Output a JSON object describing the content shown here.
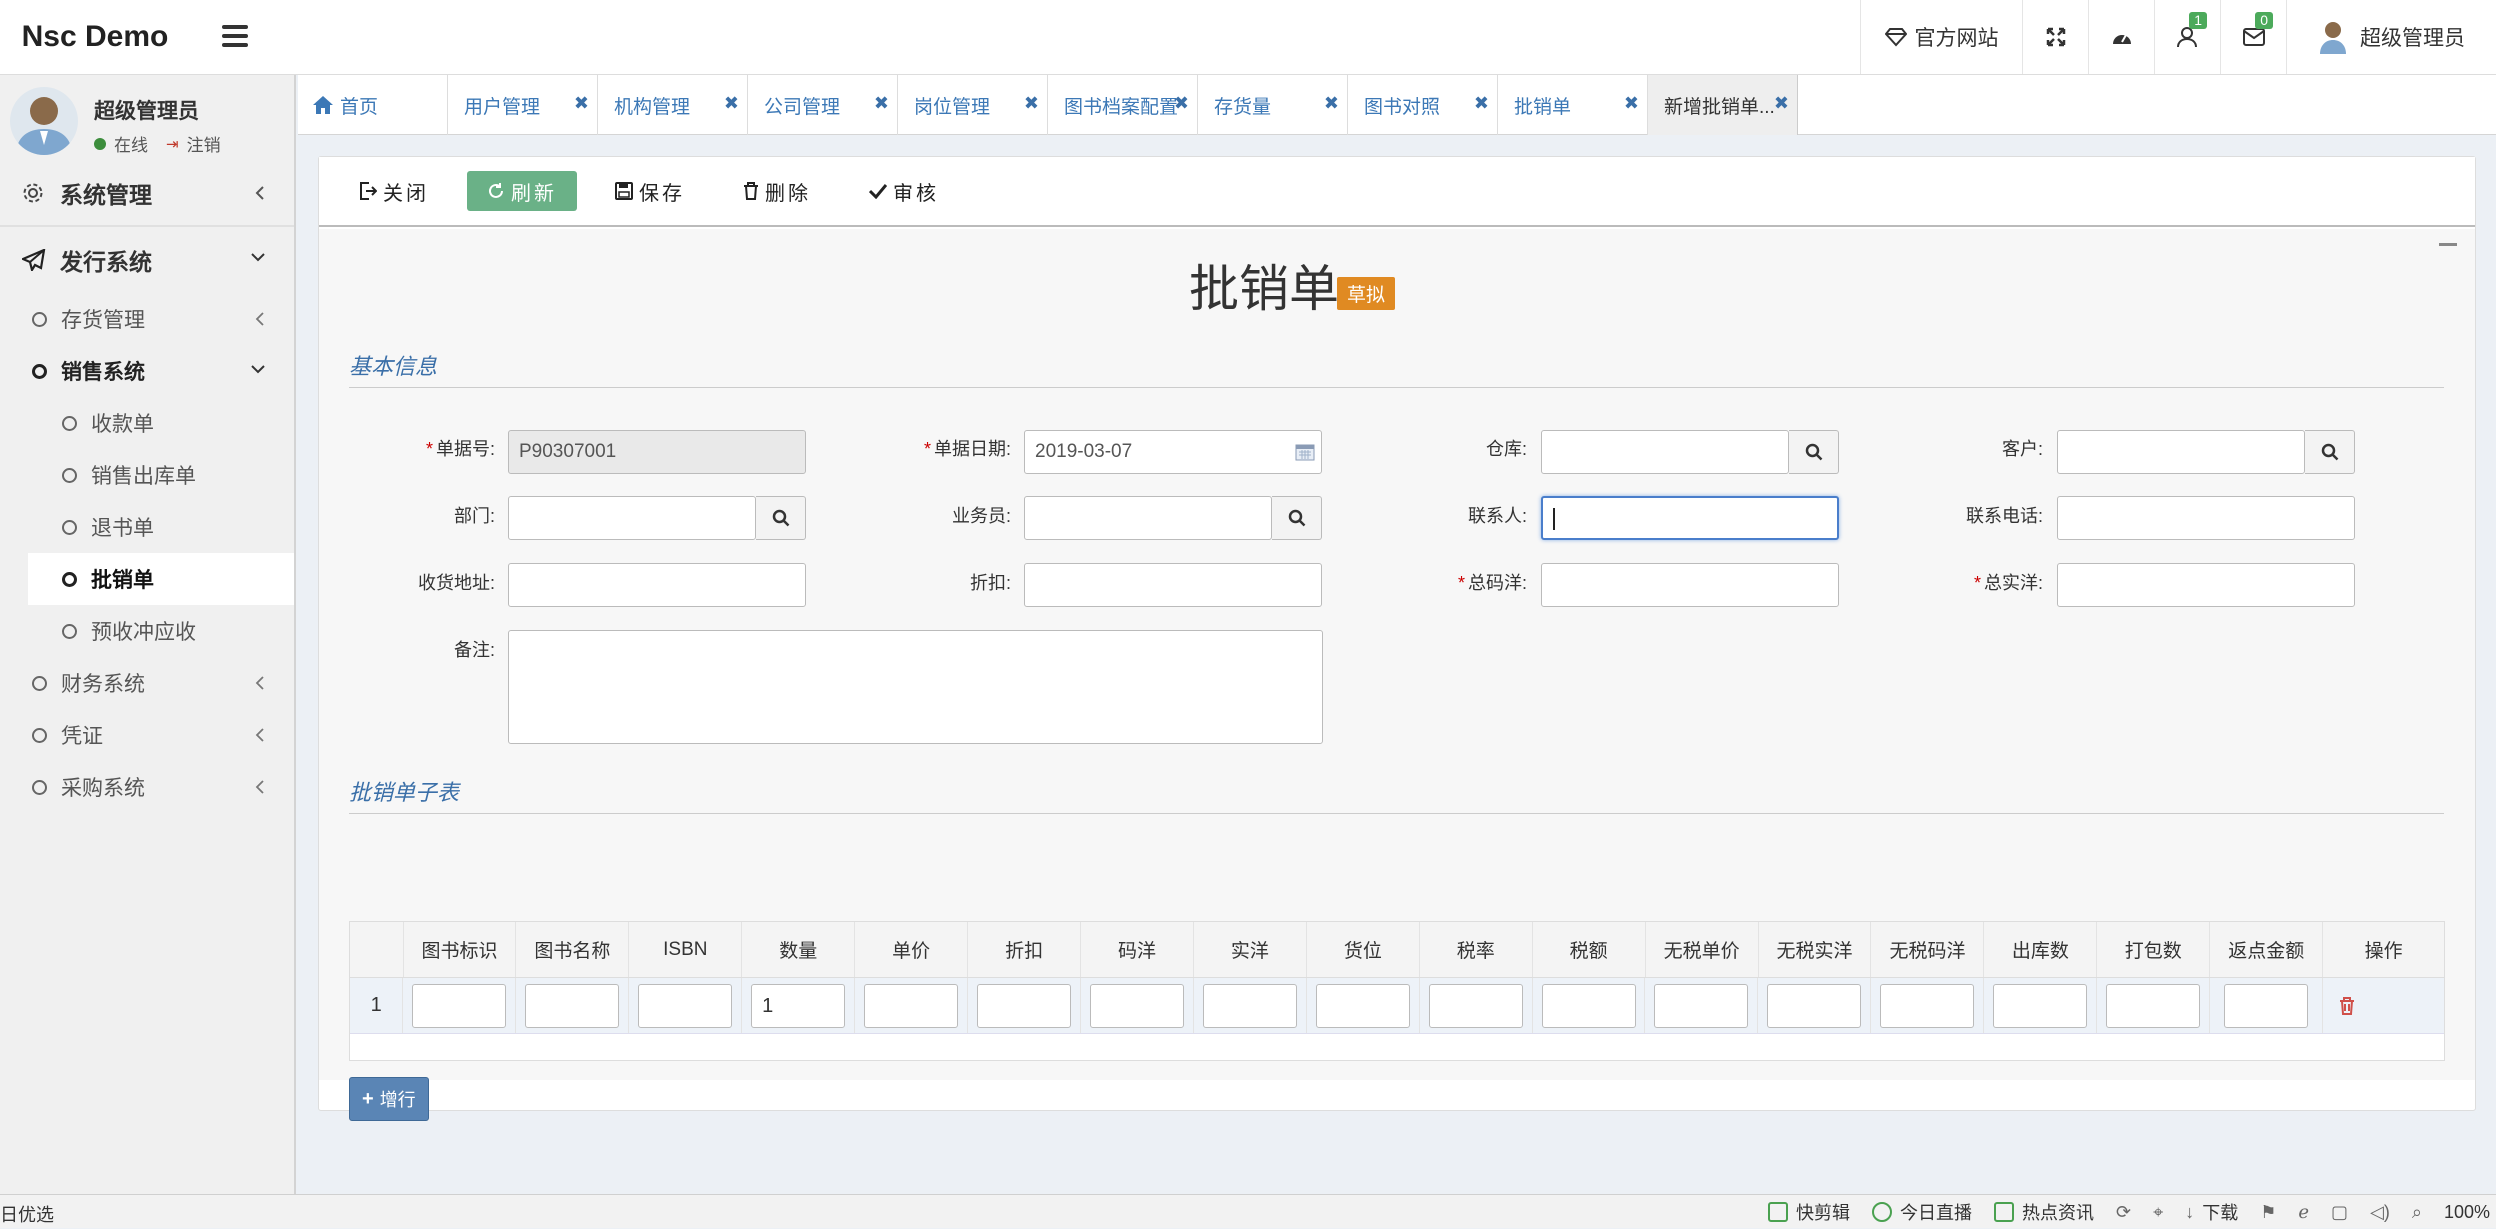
{
  "app": {
    "logo": "Nsc Demo"
  },
  "topnav": {
    "site_label": "官方网站",
    "notif_count": "1",
    "mail_count": "0",
    "user_label": "超级管理员"
  },
  "user": {
    "name": "超级管理员",
    "online": "在线",
    "logout": "注销"
  },
  "sidebar": {
    "system_mgmt": "系统管理",
    "publish": "发行系统",
    "inventory": "存货管理",
    "sales": "销售系统",
    "sales_items": [
      "收款单",
      "销售出库单",
      "退书单",
      "批销单",
      "预收冲应收"
    ],
    "finance": "财务系统",
    "voucher": "凭证",
    "purchase": "采购系统"
  },
  "tabs": {
    "home": "首页",
    "items": [
      "用户管理",
      "机构管理",
      "公司管理",
      "岗位管理",
      "图书档案配置",
      "存货量",
      "图书对照",
      "批销单",
      "新增批销单..."
    ]
  },
  "toolbar": {
    "close": "关闭",
    "refresh": "刷新",
    "save": "保存",
    "delete": "删除",
    "audit": "审核"
  },
  "form": {
    "title": "批销单",
    "status": "草拟",
    "section_basic": "基本信息",
    "section_sub": "批销单子表",
    "labels": {
      "doc_no": "单据号:",
      "doc_date": "单据日期:",
      "warehouse": "仓库:",
      "customer": "客户:",
      "dept": "部门:",
      "salesman": "业务员:",
      "contact": "联系人:",
      "phone": "联系电话:",
      "address": "收货地址:",
      "discount": "折扣:",
      "total_list": "总码洋:",
      "total_actual": "总实洋:",
      "remark": "备注:"
    },
    "values": {
      "doc_no": "P90307001",
      "doc_date": "2019-03-07"
    }
  },
  "grid": {
    "headers": [
      "图书标识",
      "图书名称",
      "ISBN",
      "数量",
      "单价",
      "折扣",
      "码洋",
      "实洋",
      "货位",
      "税率",
      "税额",
      "无税单价",
      "无税实洋",
      "无税码洋",
      "出库数",
      "打包数",
      "返点金额",
      "操作"
    ],
    "row_index": "1",
    "qty": "1"
  },
  "add_row": "增行",
  "statusbar": {
    "left": "日优选",
    "items": [
      "快剪辑",
      "今日直播",
      "热点资讯",
      "下载"
    ],
    "zoom": "100%"
  },
  "colors": {
    "accent": "#3c78b6",
    "draft": "#e08a22",
    "refresh": "#6ab187",
    "add": "#5a85b5"
  }
}
